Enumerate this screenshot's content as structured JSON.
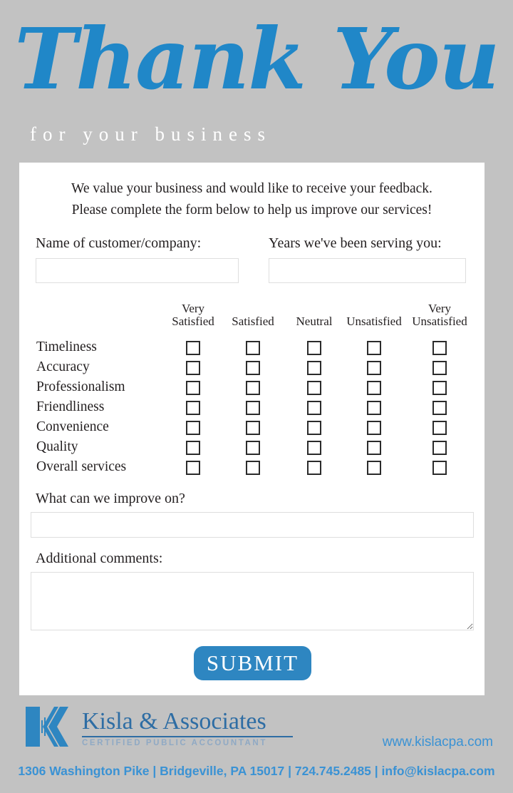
{
  "header": {
    "title": "Thank You",
    "subtitle": "for your business"
  },
  "form": {
    "intro_line1": "We value your business and would like to receive your feedback.",
    "intro_line2": "Please complete the form below to help us improve our services!",
    "name_label": "Name of customer/company:",
    "name_value": "",
    "years_label": "Years we've been serving you:",
    "years_value": "",
    "improve_label": "What can we improve on?",
    "improve_value": "",
    "comments_label": "Additional comments:",
    "comments_value": "",
    "submit_label": "SUBMIT"
  },
  "matrix": {
    "columns": [
      {
        "line1": "Very",
        "line2": "Satisfied"
      },
      {
        "line1": "",
        "line2": "Satisfied"
      },
      {
        "line1": "",
        "line2": "Neutral"
      },
      {
        "line1": "",
        "line2": "Unsatisfied"
      },
      {
        "line1": "Very",
        "line2": "Unsatisfied"
      }
    ],
    "rows": [
      "Timeliness",
      "Accuracy",
      "Professionalism",
      "Friendliness",
      "Convenience",
      "Quality",
      "Overall services"
    ]
  },
  "footer": {
    "logo_icon": "kisla-k-logo",
    "company_name": "Kisla & Associates",
    "tagline": "CERTIFIED PUBLIC ACCOUNTANT",
    "website": "www.kislacpa.com",
    "contact": "1306 Washington Pike  |  Bridgeville, PA 15017  |  724.745.2485 | info@kislacpa.com"
  },
  "colors": {
    "background": "#c2c2c2",
    "card": "#ffffff",
    "script_blue": "#2087c8",
    "button_blue": "#2e86c1",
    "logo_blue": "#2e6da4",
    "link_blue": "#3a92d4",
    "text": "#231f20"
  }
}
